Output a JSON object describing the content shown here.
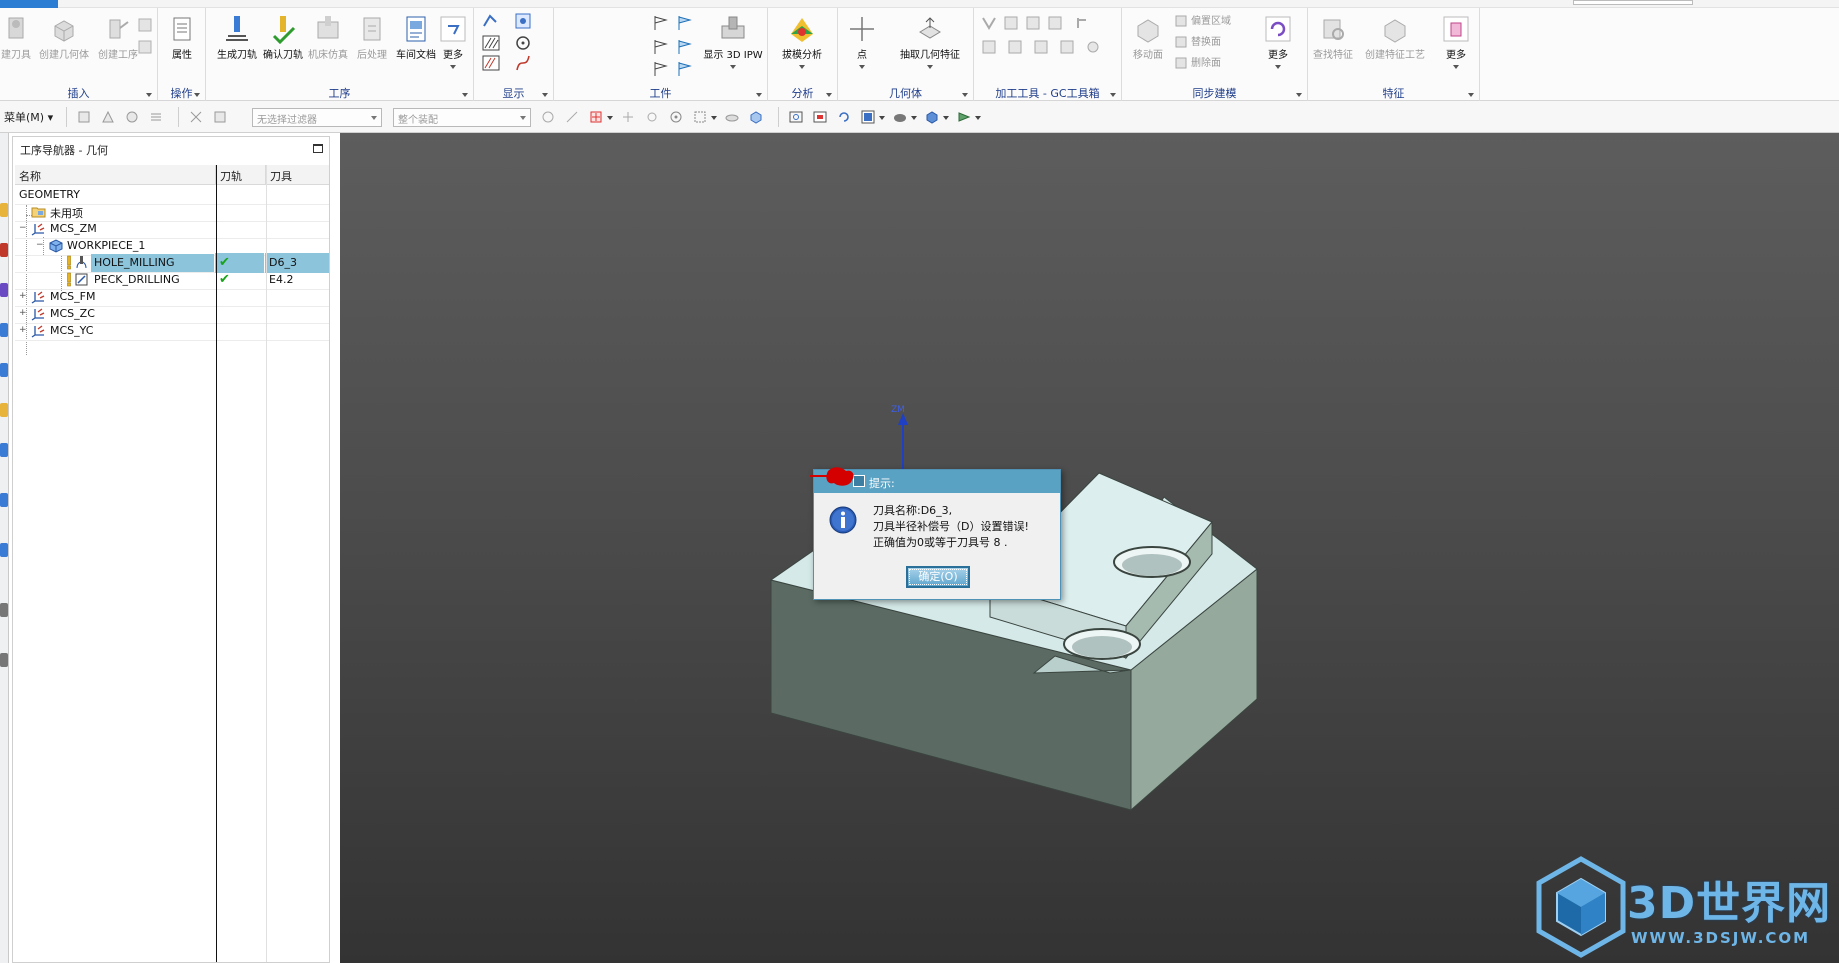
{
  "ribbon": {
    "groups": [
      {
        "title": "插入",
        "buttons": [
          "建刀具",
          "创建几何体",
          "创建工序"
        ]
      },
      {
        "title": "操作",
        "buttons": [
          "属性"
        ]
      },
      {
        "title": "工序",
        "buttons": [
          "生成刀轨",
          "确认刀轨",
          "机床仿真",
          "后处理",
          "车间文档",
          "更多"
        ]
      },
      {
        "title": "显示"
      },
      {
        "title": "工件",
        "buttons": [
          "显示 3D IPW"
        ]
      },
      {
        "title": "分析",
        "buttons": [
          "拔模分析"
        ]
      },
      {
        "title": "几何体",
        "buttons": [
          "点",
          "抽取几何特征"
        ]
      },
      {
        "title": "加工工具 - GC工具箱"
      },
      {
        "title": "同步建模",
        "buttons": [
          "移动面",
          "更多"
        ],
        "small_items": [
          "偏置区域",
          "替换面",
          "删除面"
        ]
      },
      {
        "title": "特征",
        "buttons": [
          "查找特征",
          "创建特征工艺",
          "更多"
        ]
      }
    ]
  },
  "toolbar2": {
    "menu_label": "菜单(M)",
    "filter_placeholder": "无选择过滤器",
    "assembly_placeholder": "整个装配"
  },
  "navigator": {
    "title": "工序导航器 - 几何",
    "columns": [
      "名称",
      "刀轨",
      "刀具"
    ],
    "rows": [
      {
        "name": "GEOMETRY",
        "path": "",
        "tool": ""
      },
      {
        "name": "未用项",
        "path": "",
        "tool": ""
      },
      {
        "name": "MCS_ZM",
        "path": "",
        "tool": ""
      },
      {
        "name": "WORKPIECE_1",
        "path": "",
        "tool": ""
      },
      {
        "name": "HOLE_MILLING",
        "path": "✔",
        "tool": "D6_3",
        "selected": true
      },
      {
        "name": "PECK_DRILLING",
        "path": "✔",
        "tool": "E4.2"
      },
      {
        "name": "MCS_FM",
        "path": "",
        "tool": ""
      },
      {
        "name": "MCS_ZC",
        "path": "",
        "tool": ""
      },
      {
        "name": "MCS_YC",
        "path": "",
        "tool": ""
      }
    ]
  },
  "viewport": {
    "axis_label": "ZM"
  },
  "dialog": {
    "title": "提示:",
    "lines": [
      "刀具名称:D6_3,",
      "刀具半径补偿号（D）设置错误!",
      "正确值为0或等于刀具号 8 ."
    ],
    "ok_label": "确定(O)"
  },
  "watermark": {
    "text": "3D世界网",
    "url": "WWW.3DSJW.COM"
  },
  "colors": {
    "selection": "#8cc4dc",
    "dialog_title": "#5aa2c3",
    "part_top": "#d4e9e8",
    "part_front": "#5b6b64",
    "part_side": "#95aa9c",
    "check_green": "#1aa31a",
    "group_title": "#1f3d8a"
  }
}
